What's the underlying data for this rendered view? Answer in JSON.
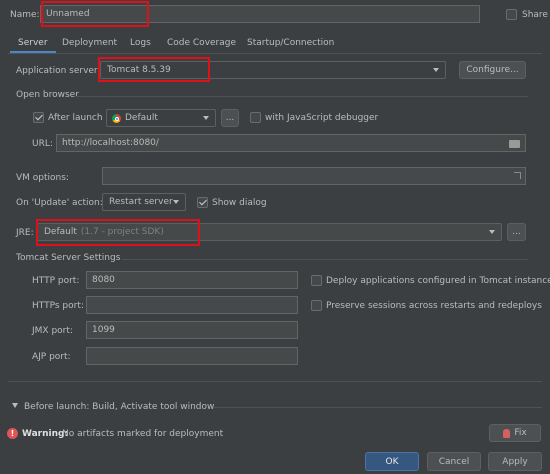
{
  "name": {
    "label": "Name:",
    "value": "Unnamed",
    "share_label": "Share"
  },
  "tabs": [
    {
      "label": "Server"
    },
    {
      "label": "Deployment"
    },
    {
      "label": "Logs"
    },
    {
      "label": "Code Coverage"
    },
    {
      "label": "Startup/Connection"
    }
  ],
  "server": {
    "app_server_label": "Application server:",
    "app_server_value": "Tomcat 8.5.39",
    "configure_label": "Configure..."
  },
  "open_browser": {
    "section_label": "Open browser",
    "after_launch_label": "After launch",
    "browser_value": "Default",
    "ellipsis": "...",
    "js_debugger_label": "with JavaScript debugger",
    "url_label": "URL:",
    "url_value": "http://localhost:8080/"
  },
  "vm": {
    "label": "VM options:",
    "value": ""
  },
  "update": {
    "label": "On 'Update' action:",
    "value": "Restart server",
    "show_dialog_label": "Show dialog"
  },
  "jre": {
    "label": "JRE:",
    "value": "Default",
    "hint": "(1.7 - project SDK)",
    "ellipsis": "..."
  },
  "tomcat": {
    "section_label": "Tomcat Server Settings",
    "http_label": "HTTP port:",
    "http_value": "8080",
    "https_label": "HTTPs port:",
    "https_value": "",
    "jmx_label": "JMX port:",
    "jmx_value": "1099",
    "ajp_label": "AJP port:",
    "ajp_value": "",
    "deploy_label": "Deploy applications configured in Tomcat instance",
    "preserve_label": "Preserve sessions across restarts and redeploys"
  },
  "before_launch": {
    "label": "Before launch: Build, Activate tool window"
  },
  "warning": {
    "title": "Warning:",
    "text": "No artifacts marked for deployment",
    "fix_label": "Fix"
  },
  "footer": {
    "ok_label": "OK",
    "cancel_label": "Cancel",
    "apply_label": "Apply"
  },
  "colors": {
    "background": "#3c3f41",
    "field": "#45494a",
    "ok_button": "#365880",
    "error": "#e05555",
    "highlight_box": "#e0101a"
  }
}
